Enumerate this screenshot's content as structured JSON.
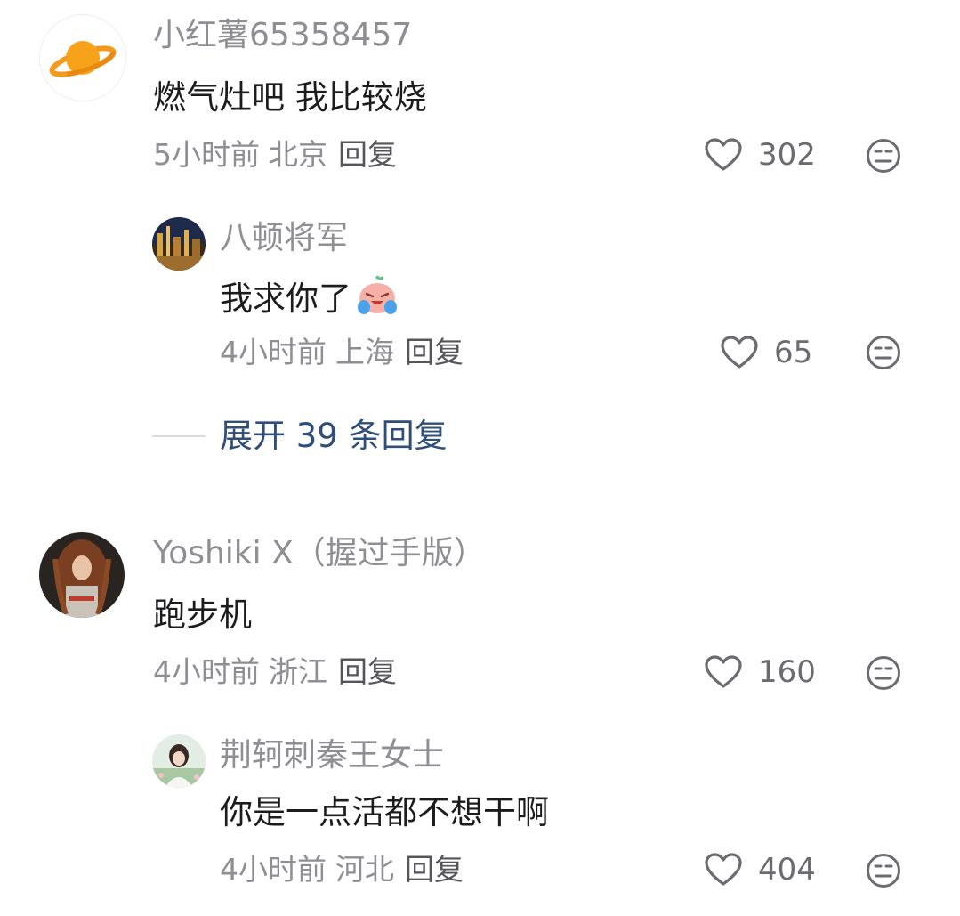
{
  "comments": [
    {
      "username": "小红薯65358457",
      "text": "燃气灶吧 我比较烧",
      "time": "5小时前",
      "location": "北京",
      "reply_label": "回复",
      "likes": "302",
      "replies": [
        {
          "username": "八顿将军",
          "text": "我求你了",
          "emoji": "crying-face-emoji",
          "time": "4小时前",
          "location": "上海",
          "reply_label": "回复",
          "likes": "65"
        }
      ],
      "expand_label": "展开 39 条回复"
    },
    {
      "username": "Yoshiki X（握过手版）",
      "text": "跑步机",
      "time": "4小时前",
      "location": "浙江",
      "reply_label": "回复",
      "likes": "160",
      "replies": [
        {
          "username": "荆轲刺秦王女士",
          "text": "你是一点活都不想干啊",
          "time": "4小时前",
          "location": "河北",
          "reply_label": "回复",
          "likes": "404"
        }
      ]
    }
  ],
  "icons": {
    "like": "heart-outline-icon",
    "dislike": "meh-face-icon"
  },
  "colors": {
    "name": "#8e8e93",
    "text": "#1c1c1e",
    "link": "#2f4f7a"
  }
}
